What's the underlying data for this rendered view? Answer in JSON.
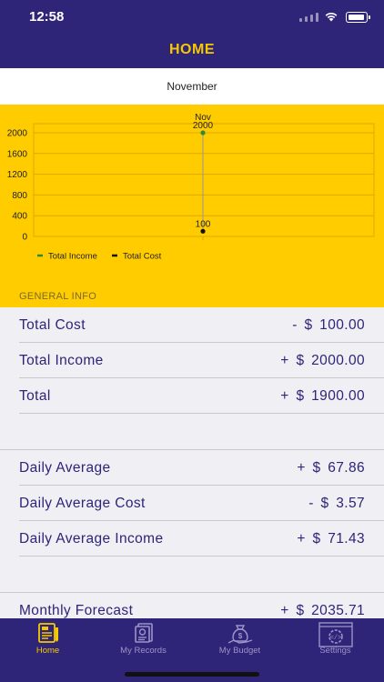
{
  "status": {
    "time": "12:58"
  },
  "nav": {
    "title": "HOME"
  },
  "month": {
    "label": "November"
  },
  "colors": {
    "navy": "#2e2478",
    "yellow": "#ffcc00",
    "accent": "#f6c800",
    "income": "#2e8b3e",
    "cost": "#111111"
  },
  "chart_data": {
    "type": "line",
    "categories": [
      "Nov"
    ],
    "series": [
      {
        "name": "Total Income",
        "values": [
          2000
        ],
        "color": "#2e8b3e"
      },
      {
        "name": "Total Cost",
        "values": [
          100
        ],
        "color": "#111111"
      }
    ],
    "data_labels": [
      "2000",
      "100"
    ],
    "yticks": [
      "2000",
      "1600",
      "1200",
      "800",
      "400",
      "0"
    ],
    "ytick_values": [
      2000,
      1600,
      1200,
      800,
      400,
      0
    ],
    "ylim": [
      0,
      2000
    ],
    "grid": true,
    "legend": "bottom-left",
    "title": "",
    "xlabel": "",
    "ylabel": ""
  },
  "general_info": {
    "header": "GENERAL INFO"
  },
  "rows": [
    {
      "label": "Total Cost",
      "value": "- $ 100.00"
    },
    {
      "label": "Total Income",
      "value": "+ $ 2000.00"
    },
    {
      "label": "Total",
      "value": "+ $ 1900.00"
    },
    {
      "label": "Daily Average",
      "value": "+ $ 67.86"
    },
    {
      "label": "Daily Average Cost",
      "value": "- $ 3.57"
    },
    {
      "label": "Daily Average Income",
      "value": "+ $ 71.43"
    },
    {
      "label": "Monthly Forecast",
      "value": "+ $ 2035.71"
    }
  ],
  "tabs": [
    {
      "label": "Home",
      "icon": "home-ledger-icon"
    },
    {
      "label": "My Records",
      "icon": "records-icon"
    },
    {
      "label": "My Budget",
      "icon": "money-bag-icon"
    },
    {
      "label": "Settings",
      "icon": "gear-code-icon"
    }
  ]
}
